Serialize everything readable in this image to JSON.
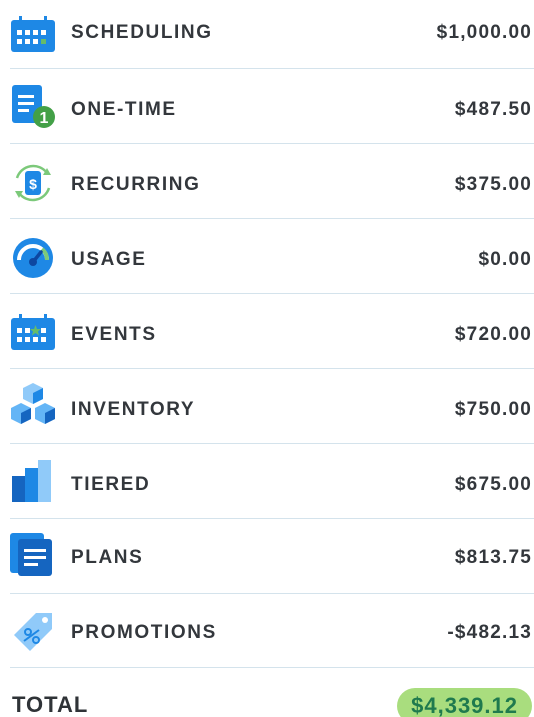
{
  "items": [
    {
      "label": "SCHEDULING",
      "amount": "$1,000.00",
      "icon": "calendar-icon"
    },
    {
      "label": "ONE-TIME",
      "amount": "$487.50",
      "icon": "one-time-document-icon"
    },
    {
      "label": "RECURRING",
      "amount": "$375.00",
      "icon": "recurring-dollar-icon"
    },
    {
      "label": "USAGE",
      "amount": "$0.00",
      "icon": "gauge-icon"
    },
    {
      "label": "EVENTS",
      "amount": "$720.00",
      "icon": "event-calendar-icon"
    },
    {
      "label": "INVENTORY",
      "amount": "$750.00",
      "icon": "cubes-icon"
    },
    {
      "label": "TIERED",
      "amount": "$675.00",
      "icon": "tiered-bars-icon"
    },
    {
      "label": "PLANS",
      "amount": "$813.75",
      "icon": "plans-stack-icon"
    },
    {
      "label": "PROMOTIONS",
      "amount": "-$482.13",
      "icon": "promo-tag-icon"
    }
  ],
  "total": {
    "label": "TOTAL",
    "amount": "$4,339.12"
  },
  "colors": {
    "icon_blue": "#1e88e5",
    "icon_dark_blue": "#1565c0",
    "icon_light_blue": "#90caf9",
    "accent_green": "#43a047",
    "total_badge_bg": "#a9dd7e",
    "total_badge_text": "#1f7a4e",
    "divider": "#d4e3ec",
    "text": "#33373c"
  }
}
